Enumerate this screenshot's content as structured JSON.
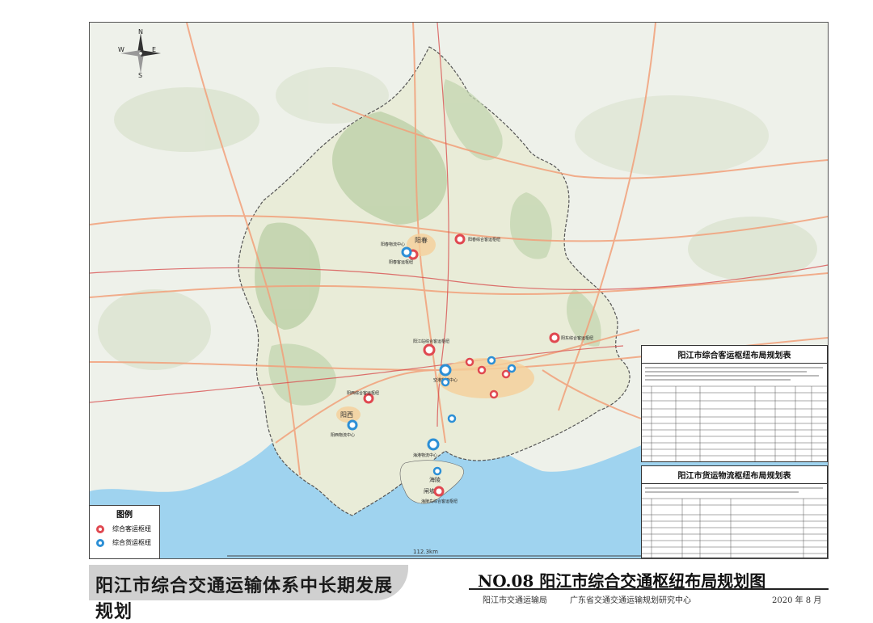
{
  "map": {
    "compass": {
      "n": "N",
      "s": "S",
      "e": "E",
      "w": "W"
    },
    "scale_label": "112.3km",
    "places": [
      {
        "id": "yangchun",
        "label": "阳春"
      },
      {
        "id": "yangxi",
        "label": "阳西"
      },
      {
        "id": "hailing",
        "label": "海陵"
      },
      {
        "id": "zhapo",
        "label": "闸坡"
      }
    ],
    "hubs": [
      {
        "type": "passenger",
        "label": "阳春客运枢纽"
      },
      {
        "type": "passenger",
        "label": "阳春综合客运枢纽"
      },
      {
        "type": "freight",
        "label": "阳春物流中心"
      },
      {
        "type": "passenger",
        "label": "阳江站综合客运枢纽"
      },
      {
        "type": "passenger",
        "label": "阳东综合客运枢纽"
      },
      {
        "type": "passenger",
        "label": "阳西综合客运枢纽"
      },
      {
        "type": "freight",
        "label": "阳西物流中心"
      },
      {
        "type": "freight",
        "label": "海港物流中心"
      },
      {
        "type": "freight",
        "label": "空港物流中心"
      },
      {
        "type": "passenger",
        "label": "海陵岛综合客运枢纽"
      }
    ]
  },
  "legend": {
    "title": "图例",
    "items": [
      {
        "label": "综合客运枢纽",
        "color": "#e04850"
      },
      {
        "label": "综合货运枢纽",
        "color": "#2c8fd6"
      }
    ]
  },
  "passenger_table": {
    "title": "阳江市综合客运枢纽布局规划表"
  },
  "freight_table": {
    "title": "阳江市货运物流枢纽布局规划表"
  },
  "footer": {
    "report_title": "阳江市综合交通运输体系中长期发展规划",
    "map_title": "NO.08 阳江市综合交通枢纽布局规划图",
    "org1": "阳江市交通运输局",
    "org2": "广东省交通交通运输规划研究中心",
    "date": "2020 年 8 月"
  },
  "colors": {
    "sea": "#9fd3ef",
    "region_fill": "#e9ecd8",
    "hill": "#b9cfa5",
    "road": "#f2a07a",
    "rail": "#d85050",
    "boundary": "#666666"
  }
}
